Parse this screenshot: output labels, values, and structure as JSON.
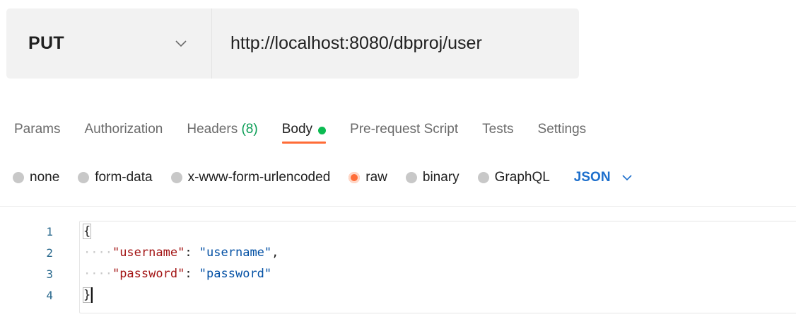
{
  "request": {
    "method": "PUT",
    "url": "http://localhost:8080/dbproj/user"
  },
  "tabs": [
    {
      "label": "Params"
    },
    {
      "label": "Authorization"
    },
    {
      "label": "Headers",
      "count": "(8)"
    },
    {
      "label": "Body",
      "active": true
    },
    {
      "label": "Pre-request Script"
    },
    {
      "label": "Tests"
    },
    {
      "label": "Settings"
    }
  ],
  "body_types": [
    {
      "label": "none"
    },
    {
      "label": "form-data"
    },
    {
      "label": "x-www-form-urlencoded"
    },
    {
      "label": "raw",
      "selected": true
    },
    {
      "label": "binary"
    },
    {
      "label": "GraphQL"
    }
  ],
  "body_format": "JSON",
  "editor": {
    "line_numbers": [
      "1",
      "2",
      "3",
      "4"
    ],
    "open_brace": "{",
    "close_brace": "}",
    "indent": "····",
    "fields": [
      {
        "key": "\"username\"",
        "value": "\"username\"",
        "trail": ","
      },
      {
        "key": "\"password\"",
        "value": "\"password\"",
        "trail": ""
      }
    ]
  },
  "colors": {
    "accent": "#ff6c37",
    "active_dot": "#0cbb52",
    "headers_count": "#0a9d55",
    "json_link": "#1d6fcc",
    "json_key": "#a31515",
    "json_string": "#0451a5"
  },
  "icons": {
    "method_chevron": "chevron-down-icon",
    "format_chevron": "chevron-down-icon"
  }
}
